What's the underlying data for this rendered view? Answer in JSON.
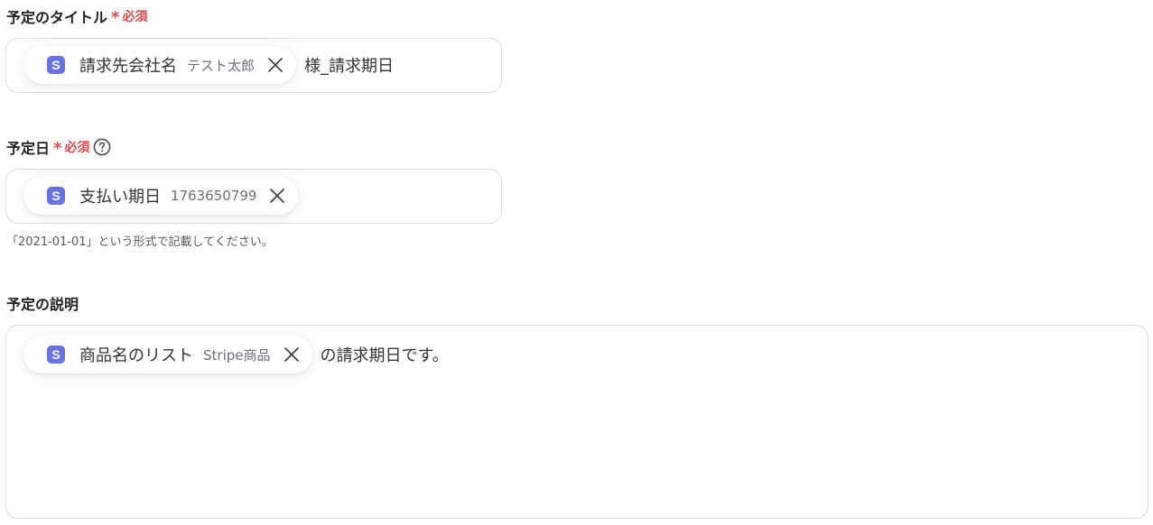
{
  "fields": {
    "title": {
      "label": "予定のタイトル",
      "required_label": "必須",
      "chip": {
        "icon": "stripe-s-icon",
        "name": "請求先会社名",
        "value": "テスト太郎"
      },
      "tail_text": "様_請求期日"
    },
    "date": {
      "label": "予定日",
      "required_label": "必須",
      "help_icon": "question-circle-icon",
      "chip": {
        "icon": "stripe-s-icon",
        "name": "支払い期日",
        "value": "1763650799"
      },
      "hint": "「2021-01-01」という形式で記載してください。"
    },
    "description": {
      "label": "予定の説明",
      "chip": {
        "icon": "stripe-s-icon",
        "name": "商品名のリスト",
        "value": "Stripe商品"
      },
      "tail_text": "の請求期日です。"
    }
  },
  "chip_icon_letter": "S",
  "required_star": "*",
  "colors": {
    "required": "#e5484d",
    "stripe_icon": "#6772e5",
    "border": "#d9dce1"
  }
}
